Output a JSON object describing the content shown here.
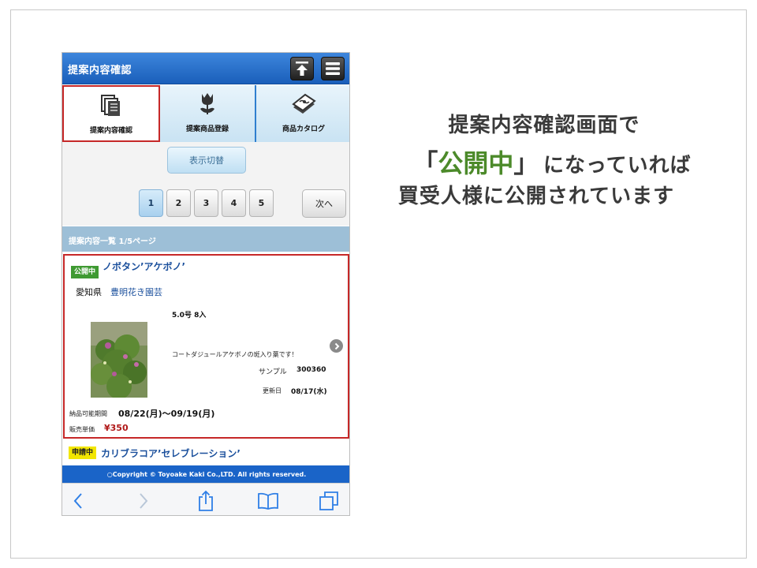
{
  "app": {
    "title": "提案内容確認"
  },
  "tabs": [
    {
      "label": "提案内容確認",
      "icon": "documents-icon",
      "active": true
    },
    {
      "label": "提案商品登録",
      "icon": "tulip-icon",
      "active": false
    },
    {
      "label": "商品カタログ",
      "icon": "catalog-icon",
      "active": false
    }
  ],
  "toggle": {
    "label": "表示切替"
  },
  "pagination": {
    "pages": [
      "1",
      "2",
      "3",
      "4",
      "5"
    ],
    "current": "1",
    "next_label": "次へ"
  },
  "list": {
    "header": "提案内容一覧 1/5ページ"
  },
  "item1": {
    "status": "公開中",
    "name": "ノボタン’アケボノ’",
    "prefecture": "愛知県",
    "vendor": "豊明花き園芸",
    "size": "5.0号 8入",
    "description": "コートダジュールアケボノの斑入り葉です！",
    "sample_label": "サンプル",
    "sample_number": "300360",
    "updated_label": "更新日",
    "updated_value": "08/17(水)",
    "period_label": "納品可能期間",
    "period_value": "08/22(月)〜09/19(月)",
    "price_label": "販売単価",
    "price_value": "¥350"
  },
  "item2": {
    "status": "申請中",
    "name": "カリブラコア’セレブレーション’"
  },
  "footer": {
    "copyright": "○Copyright © Toyoake Kaki Co.,LTD. All rights reserved."
  },
  "browser": {
    "buttons": [
      "back-icon",
      "forward-icon",
      "share-icon",
      "bookmarks-icon",
      "tabs-icon"
    ]
  },
  "caption": {
    "line1": "提案内容確認画面で",
    "line2_open": "「",
    "line2_highlight": "公開中",
    "line2_close": "」",
    "line2_rest": "になっていれば",
    "line3": "買受人様に公開されています"
  },
  "colors": {
    "header_blue": "#1a5fba",
    "highlight_green": "#4c8a2a",
    "active_border_red": "#c62828",
    "public_badge_green": "#3f9a32",
    "applying_badge_yellow": "#f2e600",
    "price_red": "#b01818"
  }
}
